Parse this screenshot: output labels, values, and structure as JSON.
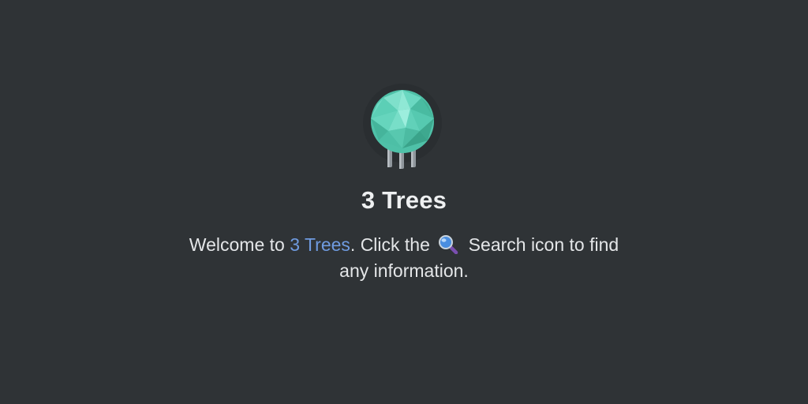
{
  "app": {
    "title": "3 Trees",
    "logo_icon": "tree-logo-icon"
  },
  "welcome": {
    "prefix": "Welcome to ",
    "link_text": "3 Trees",
    "middle": ". Click the ",
    "search_icon": "magnifying-glass-icon",
    "suffix": " Search icon to find any information."
  },
  "colors": {
    "background": "#2f3336",
    "link": "#6f9be0",
    "foliage": "#5fd0b8"
  }
}
